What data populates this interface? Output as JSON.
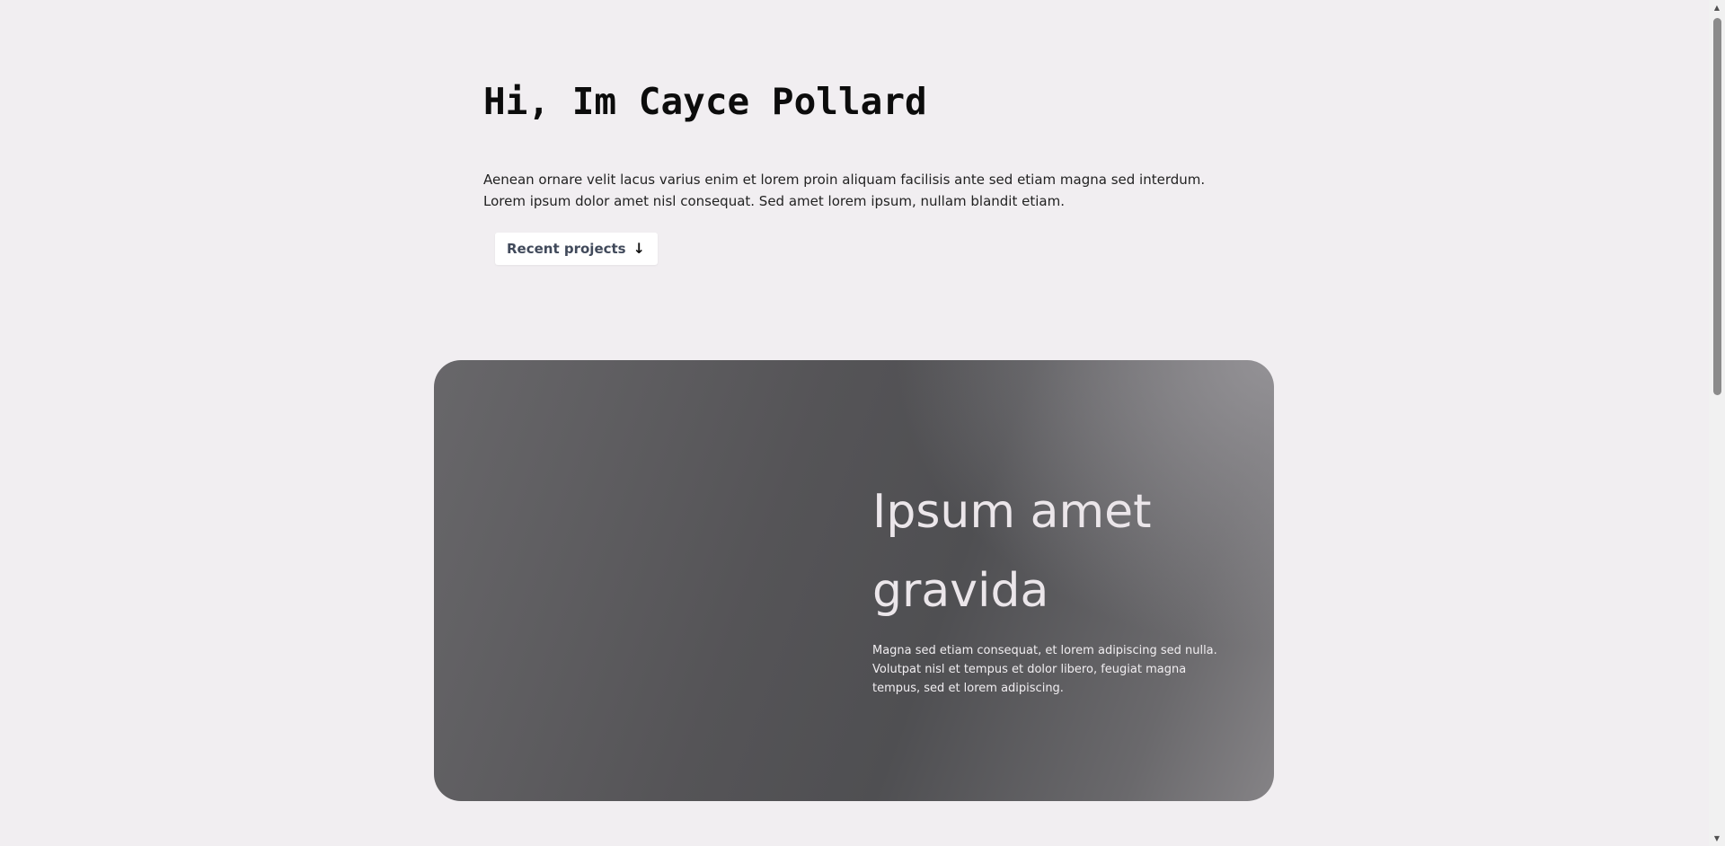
{
  "intro": {
    "heading": "Hi, Im Cayce Pollard",
    "text": "Aenean ornare velit lacus varius enim et lorem proin aliquam facilisis ante sed etiam magna sed interdum. Lorem ipsum dolor amet nisl consequat. Sed amet lorem ipsum, nullam blandit etiam."
  },
  "button": {
    "label": "Recent projects",
    "icon": "arrow-down-icon",
    "glyph": "↓"
  },
  "card": {
    "title": "Ipsum amet gravida",
    "text": "Magna sed etiam consequat, et lorem adipiscing sed nulla. Volutpat nisl et tempus et dolor libero, feugiat magna tempus, sed et lorem adipiscing."
  },
  "scrollbar": {
    "up_glyph": "▲",
    "down_glyph": "▼"
  },
  "colors": {
    "background": "#f1eef1",
    "card_dark": "#4f4f52",
    "card_light": "#858386",
    "button_text": "#414a5b"
  }
}
